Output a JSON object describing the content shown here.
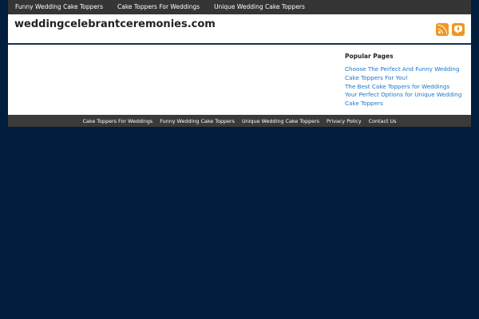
{
  "topnav": {
    "items": [
      {
        "label": "Funny Wedding Cake Toppers"
      },
      {
        "label": "Cake Toppers For Weddings"
      },
      {
        "label": "Unique Wedding Cake Toppers"
      }
    ]
  },
  "header": {
    "site_title": "weddingcelebrantceremonies.com",
    "icons": [
      "rss-icon",
      "comment-icon"
    ],
    "icon_color": "#f29522"
  },
  "sidebar": {
    "title": "Popular Pages",
    "links": [
      {
        "label": "Choose The Perfect And Funny Wedding Cake Toppers For You!"
      },
      {
        "label": "The Best Cake Toppers for Weddings"
      },
      {
        "label": "Your Perfect Options for Unique Wedding Cake Toppers"
      }
    ]
  },
  "footer": {
    "links": [
      {
        "label": "Cake Toppers For Weddings"
      },
      {
        "label": "Funny Wedding Cake Toppers"
      },
      {
        "label": "Unique Wedding Cake Toppers"
      },
      {
        "label": "Privacy Policy"
      },
      {
        "label": "Contact Us"
      }
    ]
  },
  "colors": {
    "page_background": "#021e3e",
    "nav_background": "#353535",
    "link": "#1a75c9"
  }
}
